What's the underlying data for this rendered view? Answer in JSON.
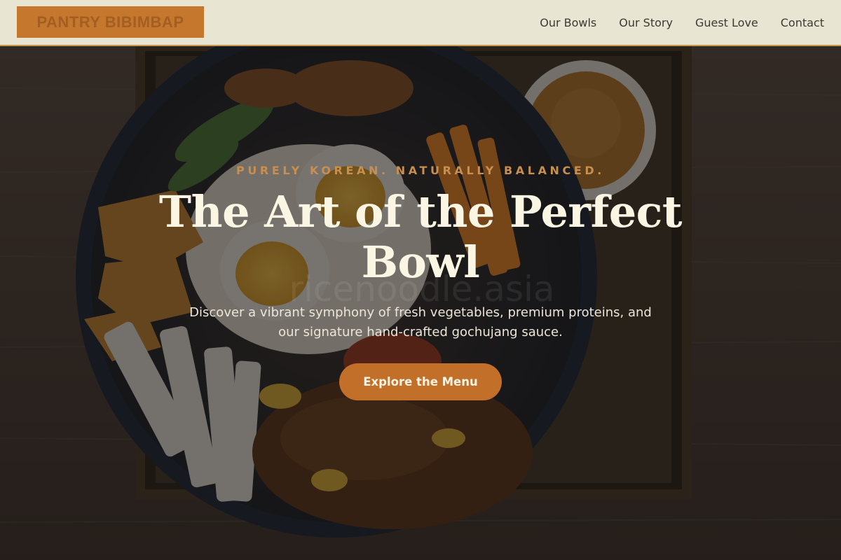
{
  "header": {
    "logo": "PANTRY BIBIMBAP",
    "nav": [
      {
        "label": "Our Bowls"
      },
      {
        "label": "Our Story"
      },
      {
        "label": "Guest Love"
      },
      {
        "label": "Contact"
      }
    ]
  },
  "hero": {
    "kicker": "PURELY KOREAN. NATURALLY BALANCED.",
    "headline": "The Art of the Perfect Bowl",
    "subtext": "Discover a vibrant symphony of fresh vegetables, premium proteins, and our signature hand-crafted gochujang sauce.",
    "cta": "Explore the Menu",
    "watermark": "ricenoodle.asia"
  },
  "colors": {
    "header_bg": "#e8e5d2",
    "accent": "#c26f2a",
    "kicker": "#c98f4e",
    "headline": "#fbf6e4"
  }
}
